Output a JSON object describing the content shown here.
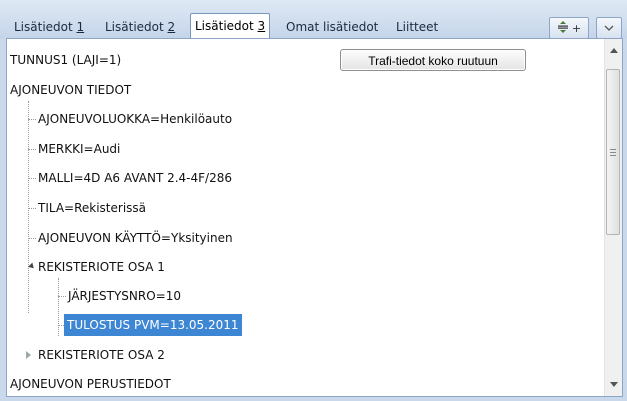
{
  "tabs": [
    {
      "prefix": "Lisätiedot ",
      "number": "1"
    },
    {
      "prefix": "Lisätiedot ",
      "number": "2"
    },
    {
      "prefix": "Lisätiedot ",
      "number": "3"
    },
    {
      "label": "Omat lisätiedot"
    },
    {
      "label": "Liitteet"
    }
  ],
  "active_tab_index": 2,
  "toolbar": {
    "expand_icon": "expand-collapse-icon",
    "plus_text": "+",
    "chevron_icon": "chevron-down-icon"
  },
  "actions": {
    "trafi_button_label": "Trafi-tiedot koko ruutuun"
  },
  "tree": {
    "root_label": "TUNNUS1 (LAJI=1)",
    "vehicle_info": {
      "label": "AJONEUVON TIEDOT",
      "children": [
        "AJONEUVOLUOKKA=Henkilöauto",
        "MERKKI=Audi",
        "MALLI=4D A6 AVANT 2.4-4F/286",
        "TILA=Rekisterissä",
        "AJONEUVON KÄYTTÖ=Yksityinen"
      ]
    },
    "register_part1": {
      "label": "REKISTERIOTE OSA 1",
      "children": [
        "JÄRJESTYSNRO=10",
        "TULOSTUS PVM=13.05.2011"
      ]
    },
    "register_part2": {
      "label": "REKISTERIOTE OSA 2"
    },
    "basic_info_label": "AJONEUVON PERUSTIEDOT"
  },
  "colors": {
    "selection": "#3d86d4",
    "tab_bar": "#c9d8ea"
  }
}
